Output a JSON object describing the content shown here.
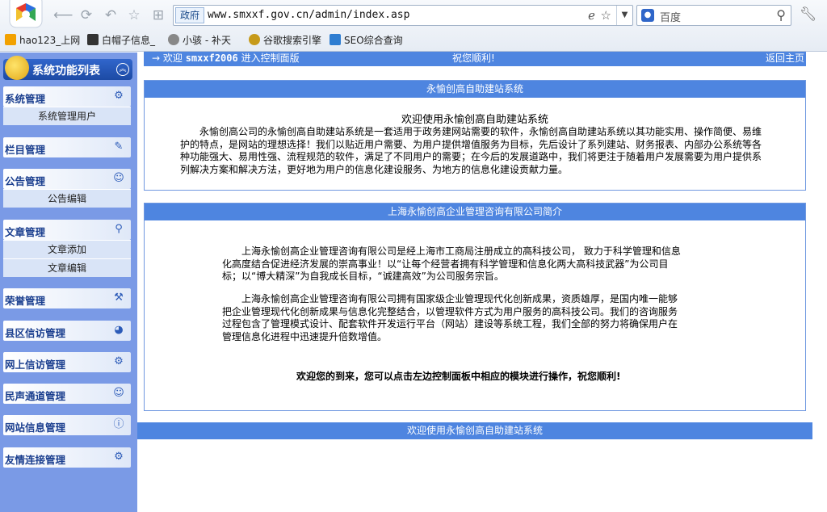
{
  "browser": {
    "address_tag": "政府",
    "url": "www.smxxf.gov.cn/admin/index.asp",
    "search_placeholder": "百度",
    "bookmarks": [
      {
        "label": "hao123_上网",
        "icon": "hao123-icon"
      },
      {
        "label": "白帽子信息_",
        "icon": "whitehat-icon"
      },
      {
        "label": "小骇 - 补天",
        "icon": "star-icon"
      },
      {
        "label": "谷歌搜索引擎",
        "icon": "google-icon"
      },
      {
        "label": "SEO综合查询",
        "icon": "seo-icon"
      }
    ]
  },
  "sidebar": {
    "title": "系统功能列表",
    "sections": [
      {
        "label": "系统管理",
        "icon": "gear-icon",
        "items": [
          "系统管理用户"
        ]
      },
      {
        "label": "栏目管理",
        "icon": "edit-icon",
        "items": []
      },
      {
        "label": "公告管理",
        "icon": "user-icon",
        "items": [
          "公告编辑"
        ]
      },
      {
        "label": "文章管理",
        "icon": "search-icon",
        "items": [
          "文章添加",
          "文章编辑"
        ]
      },
      {
        "label": "荣誉管理",
        "icon": "tools-icon",
        "items": []
      },
      {
        "label": "县区信访管理",
        "icon": "globe-icon",
        "items": []
      },
      {
        "label": "网上信访管理",
        "icon": "gear-icon",
        "items": []
      },
      {
        "label": "民声通道管理",
        "icon": "user-icon",
        "items": []
      },
      {
        "label": "网站信息管理",
        "icon": "info-icon",
        "items": []
      },
      {
        "label": "友情连接管理",
        "icon": "gear-icon",
        "items": []
      }
    ]
  },
  "topbar": {
    "welcome_prefix": "→ 欢迎",
    "username": "smxxf2006",
    "welcome_suffix": "进入控制面版",
    "wish": "祝您顺利!",
    "home_link": "返回主页"
  },
  "panel1": {
    "header": "永愉创高自助建站系统",
    "welcome": "欢迎使用永愉创高自助建站系统",
    "body": "永愉创高公司的永愉创高自助建站系统是一套适用于政务建网站需要的软件，永愉创高自助建站系统以其功能实用、操作简便、易维护的特点，是网站的理想选择！我们以贴近用户需要、为用户提供增值服务为目标，先后设计了系列建站、财务报表、内部办公系统等各种功能强大、易用性强、流程规范的软件，满足了不同用户的需要；在今后的发展道路中，我们将更注于随着用户发展需要为用户提供系列解决方案和解决方法，更好地为用户的信息化建设服务、为地方的信息化建设贡献力量。"
  },
  "panel2": {
    "header": "上海永愉创高企业管理咨询有限公司简介",
    "para1": "上海永愉创高企业管理咨询有限公司是经上海市工商局注册成立的高科技公司， 致力于科学管理和信息化高度结合促进经济发展的崇高事业！以“让每个经营者拥有科学管理和信息化两大高科技武器”为公司目标；以“博大精深”为自我成长目标，“诚建高效”为公司服务宗旨。",
    "para2": "上海永愉创高企业管理咨询有限公司拥有国家级企业管理现代化创新成果，资质雄厚，是国内唯一能够把企业管理现代化创新成果与信息化完整结合，以管理软件方式为用户服务的高科技公司。我们的咨询服务过程包含了管理模式设计、配套软件开发运行平台（网站）建设等系统工程，我们全部的努力将确保用户在管理信息化进程中迅速提升倍数增值。",
    "closing": "欢迎您的到来，您可以点击左边控制面板中相应的模块进行操作，祝您顺利!"
  },
  "footer": "欢迎使用永愉创高自助建站系统"
}
